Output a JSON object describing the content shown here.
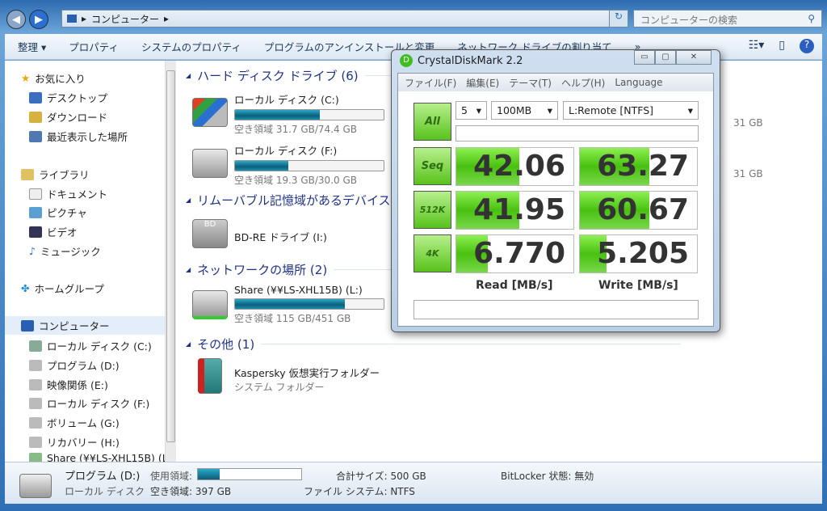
{
  "address": {
    "path": "コンピューター",
    "search_placeholder": "コンピューターの検索"
  },
  "toolbar": {
    "items": [
      "整理 ▾",
      "プロパティ",
      "システムのプロパティ",
      "プログラムのアンインストールと変更",
      "ネットワーク ドライブの割り当て",
      "»"
    ]
  },
  "sidebar": {
    "items": [
      "お気に入り",
      "デスクトップ",
      "ダウンロード",
      "最近表示した場所",
      "ライブラリ",
      "ドキュメント",
      "ピクチャ",
      "ビデオ",
      "ミュージック",
      "ホームグループ",
      "コンピューター",
      "ローカル ディスク (C:)",
      "プログラム (D:)",
      "映像関係 (E:)",
      "ローカル ディスク (F:)",
      "ボリューム (G:)",
      "リカバリー (H:)",
      "Share (¥¥LS-XHL15B) (L:"
    ]
  },
  "groups": {
    "hdd": "ハード ディスク ドライブ (6)",
    "removable": "リムーバブル記憶域があるデバイス (",
    "network": "ネットワークの場所 (2)",
    "other": "その他 (1)"
  },
  "drives": [
    {
      "name": "ローカル ディスク (C:)",
      "free": "空き領域 31.7 GB/74.4 GB",
      "used_pct": 57
    },
    {
      "name": "ローカル ディスク (F:)",
      "free": "空き領域 19.3 GB/30.0 GB",
      "used_pct": 36
    },
    {
      "name": "BD-RE ドライブ (I:)"
    },
    {
      "name": "Share (¥¥LS-XHL15B) (L:)",
      "free": "空き領域 115 GB/451 GB",
      "used_pct": 74
    },
    {
      "name": "Kaspersky 仮想実行フォルダー",
      "free": "システム フォルダー"
    }
  ],
  "hidden_right": [
    "31 GB",
    "31 GB"
  ],
  "status": {
    "name": "プログラム (D:)",
    "type": "ローカル ディスク",
    "used_label": "使用領域:",
    "used_pct": 21,
    "free": "空き領域: 397 GB",
    "total": "合計サイズ: 500 GB",
    "fs": "ファイル システム: NTFS",
    "bitlocker": "BitLocker 状態: 無効"
  },
  "cdm": {
    "title": "CrystalDiskMark 2.2",
    "menu": [
      "ファイル(F)",
      "編集(E)",
      "テーマ(T)",
      "ヘルプ(H)",
      "Language"
    ],
    "count": "5",
    "size": "100MB",
    "drive": "L:Remote [NTFS]",
    "buttons": [
      "All",
      "Seq",
      "512K",
      "4K"
    ],
    "read": [
      "42.06",
      "41.95",
      "6.770"
    ],
    "write": [
      "63.27",
      "60.67",
      "5.205"
    ],
    "read_fill_pct": [
      54,
      54,
      27
    ],
    "write_fill_pct": [
      59,
      59,
      23
    ],
    "read_label": "Read [MB/s]",
    "write_label": "Write [MB/s]"
  }
}
